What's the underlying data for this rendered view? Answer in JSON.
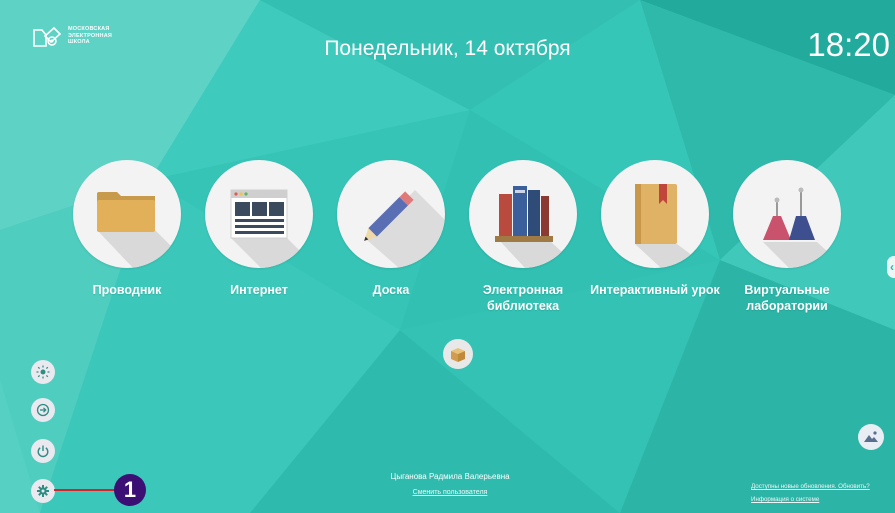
{
  "logo": {
    "lines": [
      "МОСКОВСКАЯ",
      "ЭЛЕКТРОННАЯ",
      "ШКОЛА"
    ],
    "icon": "mesh-logo-icon"
  },
  "date": "Понедельник, 14 октября",
  "clock": "18:20",
  "apps": [
    {
      "label": "Проводник",
      "icon": "folder-icon"
    },
    {
      "label": "Интернет",
      "icon": "browser-window-icon"
    },
    {
      "label": "Доска",
      "icon": "pencil-icon"
    },
    {
      "label": "Электронная библиотека",
      "icon": "books-icon"
    },
    {
      "label": "Интерактивный урок",
      "icon": "book-bookmark-icon"
    },
    {
      "label": "Виртуальные лаборатории",
      "icon": "flasks-icon"
    }
  ],
  "sidebar": [
    "brightness-icon",
    "login-arrow-icon",
    "power-icon",
    "settings-gear-icon"
  ],
  "callout": "1",
  "user": {
    "name": "Цыганова Радмила Валерьевна",
    "switch_link": "Сменить пользователя"
  },
  "updates": {
    "available": "Доступны новые обновления. Обновить?",
    "system_info": "Информация о системе"
  },
  "colors": {
    "background": "#34c3b5",
    "callout": "#3b0f74",
    "callout_line": "#d6232a"
  }
}
